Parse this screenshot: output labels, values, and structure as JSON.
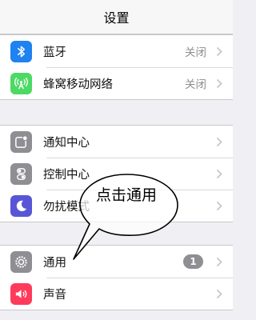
{
  "navbar": {
    "title": "设置"
  },
  "group1": [
    {
      "label": "蓝牙",
      "value": "关闭",
      "icon": "bluetooth-icon",
      "color": "#1e82f0"
    },
    {
      "label": "蜂窝移动网络",
      "value": "关闭",
      "icon": "cellular-antenna-icon",
      "color": "#4cd964"
    }
  ],
  "group2": [
    {
      "label": "通知中心",
      "icon": "notification-center-icon",
      "color": "#8e8e93"
    },
    {
      "label": "控制中心",
      "icon": "control-center-toggles-icon",
      "color": "#8e8e93"
    },
    {
      "label": "勿扰模式",
      "icon": "moon-icon",
      "color": "#5856d6"
    }
  ],
  "group3": [
    {
      "label": "通用",
      "badge": "1",
      "icon": "gear-icon",
      "color": "#8e8e93"
    },
    {
      "label": "声音",
      "icon": "speaker-icon",
      "color": "#ff3b5c"
    }
  ],
  "callout": {
    "text": "点击通用"
  }
}
